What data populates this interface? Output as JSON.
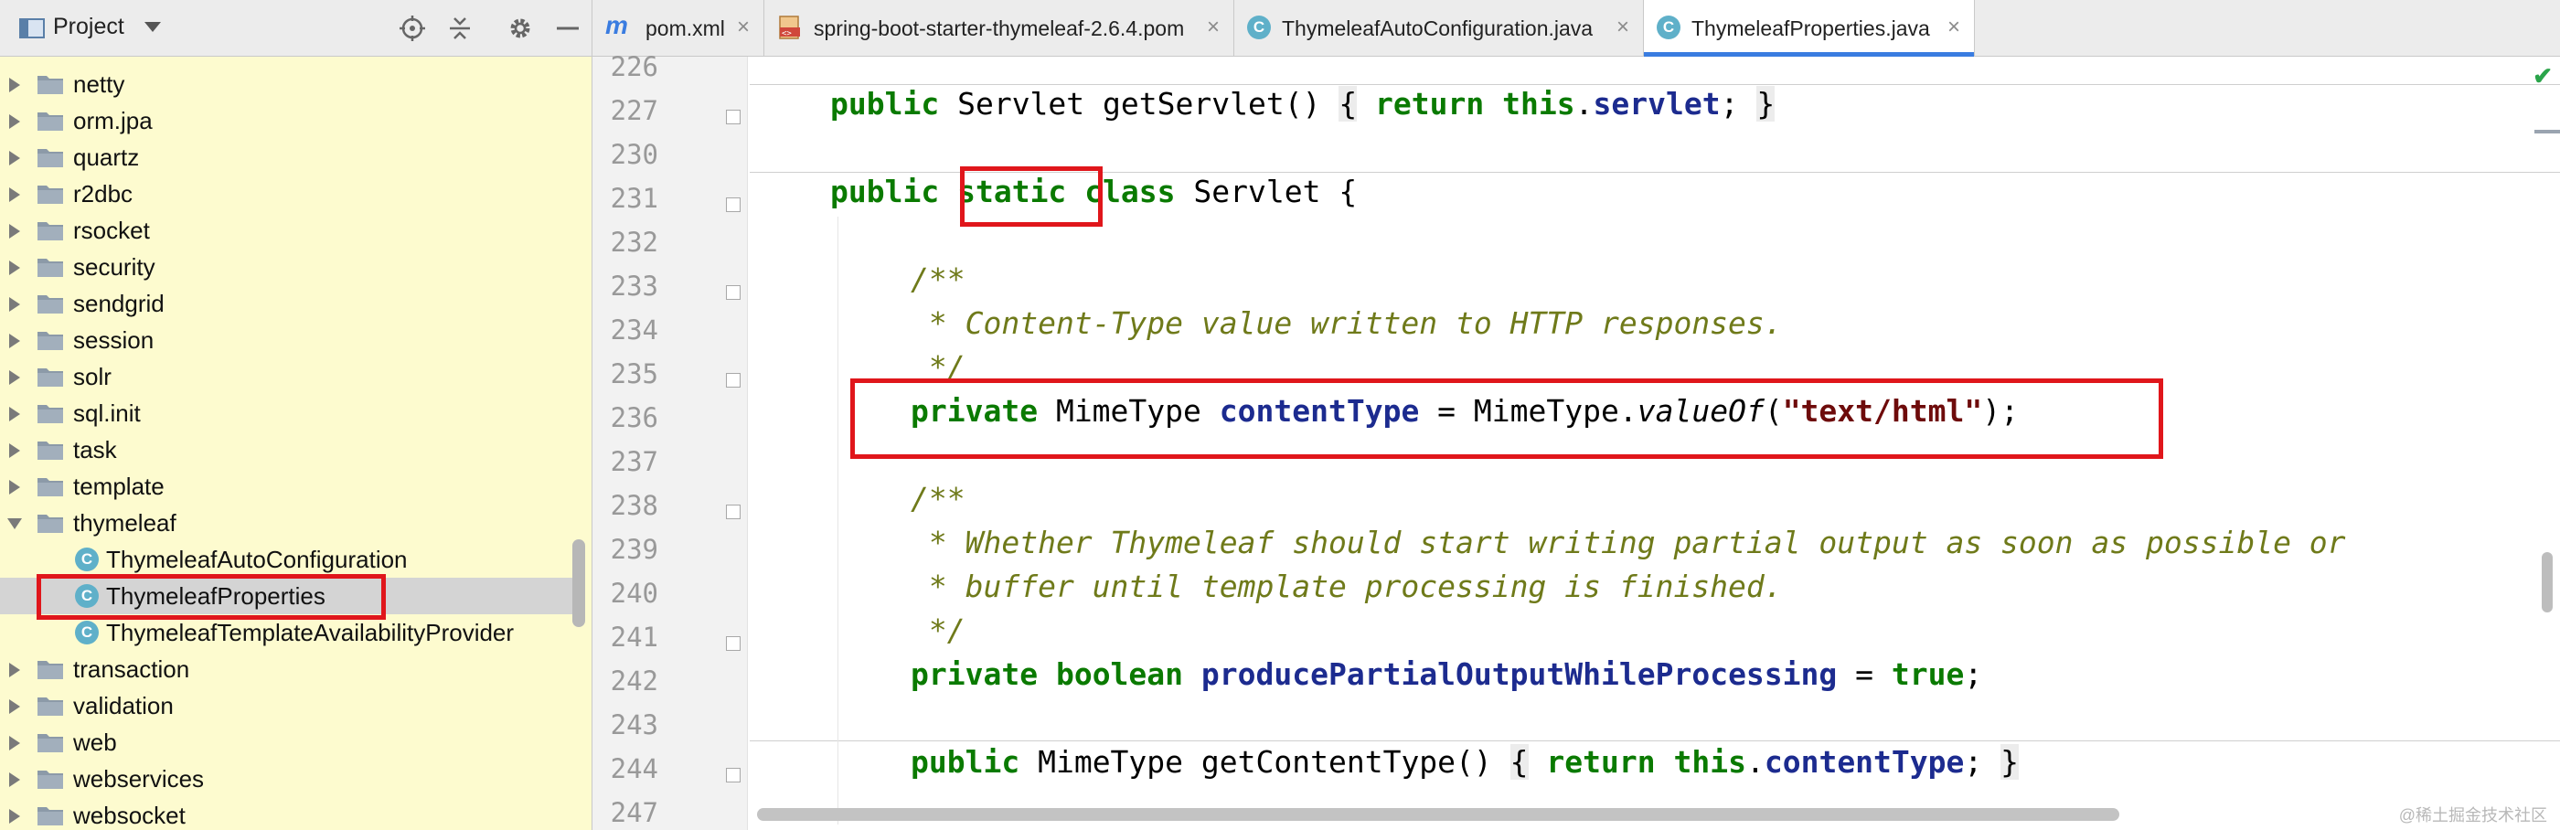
{
  "project_panel": {
    "title": "Project",
    "tree": [
      {
        "label": "netty",
        "kind": "folder",
        "expanded": false
      },
      {
        "label": "orm.jpa",
        "kind": "folder",
        "expanded": false
      },
      {
        "label": "quartz",
        "kind": "folder",
        "expanded": false
      },
      {
        "label": "r2dbc",
        "kind": "folder",
        "expanded": false
      },
      {
        "label": "rsocket",
        "kind": "folder",
        "expanded": false
      },
      {
        "label": "security",
        "kind": "folder",
        "expanded": false
      },
      {
        "label": "sendgrid",
        "kind": "folder",
        "expanded": false
      },
      {
        "label": "session",
        "kind": "folder",
        "expanded": false
      },
      {
        "label": "solr",
        "kind": "folder",
        "expanded": false
      },
      {
        "label": "sql.init",
        "kind": "folder",
        "expanded": false
      },
      {
        "label": "task",
        "kind": "folder",
        "expanded": false
      },
      {
        "label": "template",
        "kind": "folder",
        "expanded": false
      },
      {
        "label": "thymeleaf",
        "kind": "folder",
        "expanded": true
      },
      {
        "label": "ThymeleafAutoConfiguration",
        "kind": "class",
        "class_letter": "C"
      },
      {
        "label": "ThymeleafProperties",
        "kind": "class",
        "class_letter": "C",
        "selected": true
      },
      {
        "label": "ThymeleafTemplateAvailabilityProvider",
        "kind": "class",
        "class_letter": "C"
      },
      {
        "label": "transaction",
        "kind": "folder",
        "expanded": false
      },
      {
        "label": "validation",
        "kind": "folder",
        "expanded": false
      },
      {
        "label": "web",
        "kind": "folder",
        "expanded": false
      },
      {
        "label": "webservices",
        "kind": "folder",
        "expanded": false
      },
      {
        "label": "websocket",
        "kind": "folder",
        "expanded": false
      }
    ]
  },
  "tabs": [
    {
      "label": "pom.xml",
      "icon": "maven-icon",
      "icon_glyph": "m"
    },
    {
      "label": "spring-boot-starter-thymeleaf-2.6.4.pom",
      "icon": "xml-file-icon"
    },
    {
      "label": "ThymeleafAutoConfiguration.java",
      "icon": "class-icon",
      "icon_glyph": "C"
    },
    {
      "label": "ThymeleafProperties.java",
      "icon": "class-icon",
      "icon_glyph": "C",
      "active": true
    }
  ],
  "editor": {
    "line_numbers": [
      "226",
      "227",
      "230",
      "231",
      "232",
      "233",
      "234",
      "235",
      "236",
      "237",
      "238",
      "239",
      "240",
      "241",
      "242",
      "243",
      "244",
      "247"
    ],
    "code": {
      "l227": {
        "kw1": "public",
        "t1": " Servlet getServlet() ",
        "lb": "{",
        "kw2": " return ",
        "kw3": "this",
        "dot": ".",
        "f1": "servlet",
        "semi": "; ",
        "rb": "}"
      },
      "l231": {
        "kw1": "public",
        "kw2": "static",
        "kw3": "class",
        "t1": " Servlet {"
      },
      "l233": {
        "c": "/**"
      },
      "l234": {
        "c": " * Content-Type value written to HTTP responses."
      },
      "l235": {
        "c": " */"
      },
      "l236": {
        "kw1": "private",
        "t1": " MimeType ",
        "f1": "contentType",
        "t2": " = MimeType.",
        "m1": "valueOf",
        "t3": "(",
        "s1": "\"text/html\"",
        "t4": ");"
      },
      "l238": {
        "c": "/**"
      },
      "l239": {
        "c": " * Whether Thymeleaf should start writing partial output as soon as possible or"
      },
      "l240": {
        "c": " * buffer until template processing is finished."
      },
      "l241": {
        "c": " */"
      },
      "l242": {
        "kw1": "private",
        "kw2": "boolean",
        "f1": "producePartialOutputWhileProcessing",
        "t1": " = ",
        "kw3": "true",
        "t2": ";"
      },
      "l244": {
        "kw1": "public",
        "t1": " MimeType getContentType() ",
        "lb": "{",
        "kw2": " return ",
        "kw3": "this",
        "dot": ".",
        "f1": "contentType",
        "semi": "; ",
        "rb": "}"
      }
    },
    "status_check": "✔",
    "watermark": "@稀土掘金技术社区"
  },
  "colors": {
    "highlight_box": "#e0161b",
    "keyword": "#0a7a00",
    "field": "#1c2b8f",
    "string": "#6e0b0b",
    "comment": "#6f7a1a",
    "project_panel_bg": "#fdfbcf",
    "active_tab_underline": "#3a7ce0"
  }
}
